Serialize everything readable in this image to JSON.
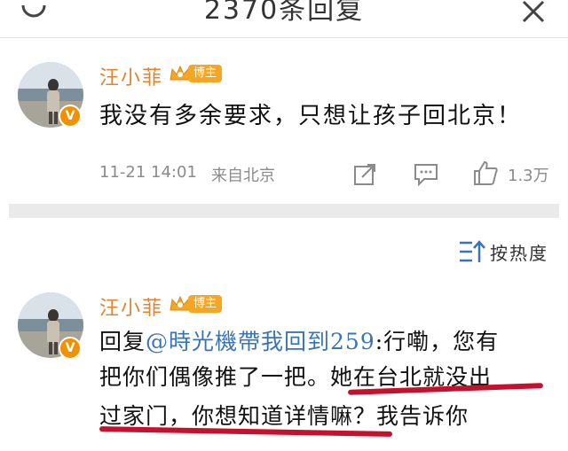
{
  "header": {
    "title": "2370条回复"
  },
  "comment": {
    "author": "汪小菲",
    "badge": "博主",
    "text": "我没有多余要求，只想让孩子回北京！",
    "time": "11-21 14:01",
    "location": "来自北京",
    "likes": "1.3万"
  },
  "sort": {
    "label": "按热度"
  },
  "reply": {
    "author": "汪小菲",
    "badge": "博主",
    "prefix": "回复",
    "mention": "@時光機帶我回到259",
    "line1_rest": ":行嘞，您有",
    "line2": "把你们偶像推了一把。她在台北就没出",
    "line3": "过家门，你想知道详情嘛？我告诉你"
  },
  "colors": {
    "name_orange": "#e4832d",
    "mention_blue": "#3a74b8",
    "highlight_red": "#c5112b"
  }
}
